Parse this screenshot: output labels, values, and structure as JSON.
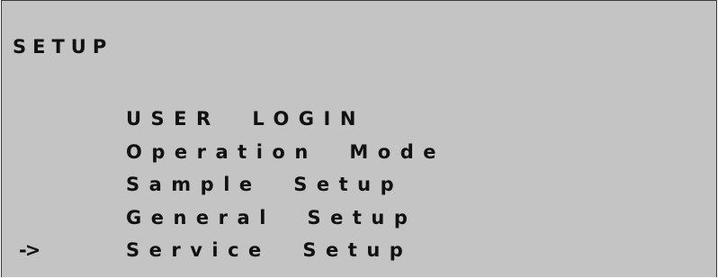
{
  "screen": {
    "title": "SETUP",
    "cursor": "->",
    "menu_items": [
      {
        "label": "USER  LOGIN",
        "selected": false
      },
      {
        "label": "Operation  Mode",
        "selected": false
      },
      {
        "label": "Sample  Setup",
        "selected": false
      },
      {
        "label": "General  Setup",
        "selected": false
      },
      {
        "label": "Service  Setup",
        "selected": true
      }
    ]
  }
}
